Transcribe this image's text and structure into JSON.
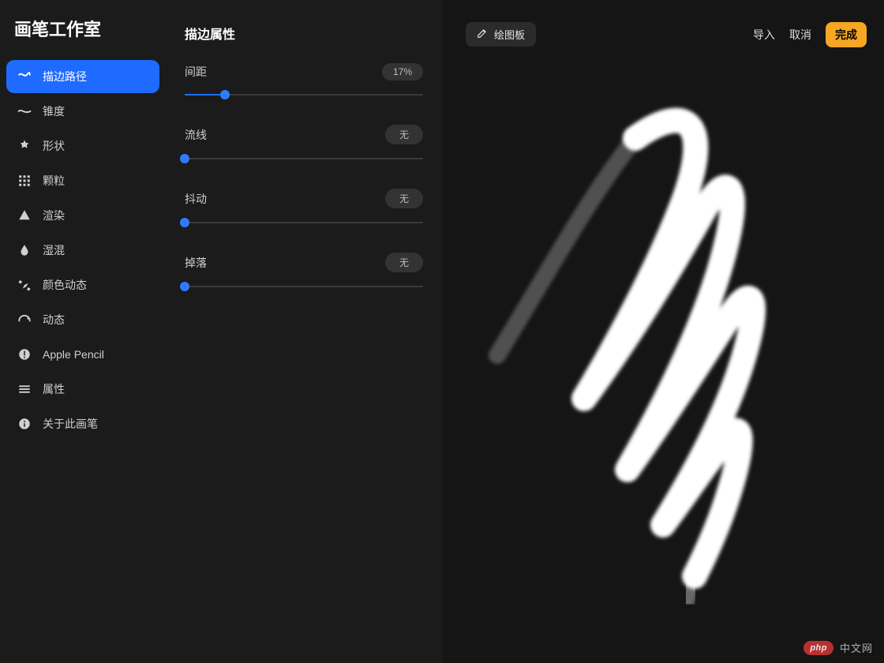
{
  "app_title": "画笔工作室",
  "sidebar": {
    "items": [
      {
        "label": "描边路径",
        "icon": "path-icon",
        "active": true
      },
      {
        "label": "锥度",
        "icon": "taper-icon",
        "active": false
      },
      {
        "label": "形状",
        "icon": "shape-icon",
        "active": false
      },
      {
        "label": "颗粒",
        "icon": "grain-icon",
        "active": false
      },
      {
        "label": "渲染",
        "icon": "render-icon",
        "active": false
      },
      {
        "label": "湿混",
        "icon": "wetmix-icon",
        "active": false
      },
      {
        "label": "颜色动态",
        "icon": "colordyn-icon",
        "active": false
      },
      {
        "label": "动态",
        "icon": "dynamics-icon",
        "active": false
      },
      {
        "label": "Apple Pencil",
        "icon": "pencil-icon",
        "active": false
      },
      {
        "label": "属性",
        "icon": "properties-icon",
        "active": false
      },
      {
        "label": "关于此画笔",
        "icon": "about-icon",
        "active": false
      }
    ]
  },
  "settings": {
    "title": "描边属性",
    "props": [
      {
        "label": "间距",
        "value": "17%",
        "percent": 17
      },
      {
        "label": "流线",
        "value": "无",
        "percent": 0
      },
      {
        "label": "抖动",
        "value": "无",
        "percent": 0
      },
      {
        "label": "掉落",
        "value": "无",
        "percent": 0
      }
    ]
  },
  "toolbar": {
    "draw_label": "绘图板",
    "import_label": "导入",
    "cancel_label": "取消",
    "done_label": "完成"
  },
  "watermark": {
    "badge": "php",
    "text": "中文网"
  }
}
